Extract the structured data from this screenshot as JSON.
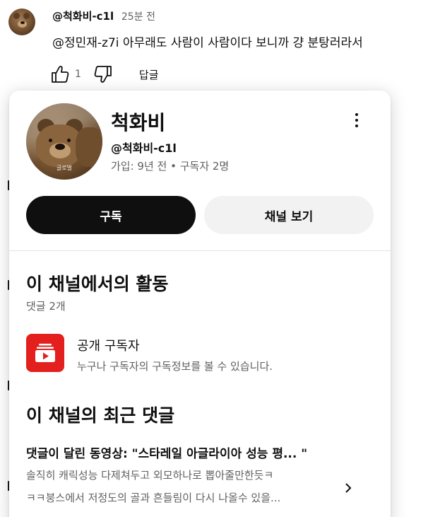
{
  "comment": {
    "author": "@척화비-c1l",
    "time": "25분 전",
    "text": "@정민재-z7i 아무래도 사람이 사람이다 보니까 걍 분탕러라서",
    "like_count": "1",
    "reply_label": "답글",
    "icons": [
      "thumb-up-icon",
      "thumb-down-icon"
    ]
  },
  "channel_card": {
    "name": "척화비",
    "handle": "@척화비-c1l",
    "meta": "가입: 9년 전 • 구독자 2명",
    "avatar_watermark": "글로벌",
    "subscribe_label": "구독",
    "view_channel_label": "채널 보기",
    "activity": {
      "title": "이 채널에서의 활동",
      "subtitle": "댓글 2개"
    },
    "public_subscriber": {
      "title": "공개 구독자",
      "description": "누구나 구독자의 구독정보를 볼 수 있습니다.",
      "icon": "subscriptions-icon",
      "icon_color": "#e3201e"
    },
    "recent_comments": {
      "title": "이 채널의 최근 댓글",
      "video_line": "댓글이 달린 동영상: \"스타레일 아글라이아 성능 평...  \"",
      "comment_line1": "솔직히 캐릭성능 다제쳐두고 외모하나로 뽑아줄만한듯ㅋ",
      "comment_line2": "ㅋㅋ붕스에서 저정도의 골과 흔들림이 다시 나올수 있을..."
    }
  },
  "colors": {
    "subscribe_bg": "#0f0f0f",
    "view_channel_bg": "#f2f2f2",
    "secondary_text": "#606060"
  }
}
